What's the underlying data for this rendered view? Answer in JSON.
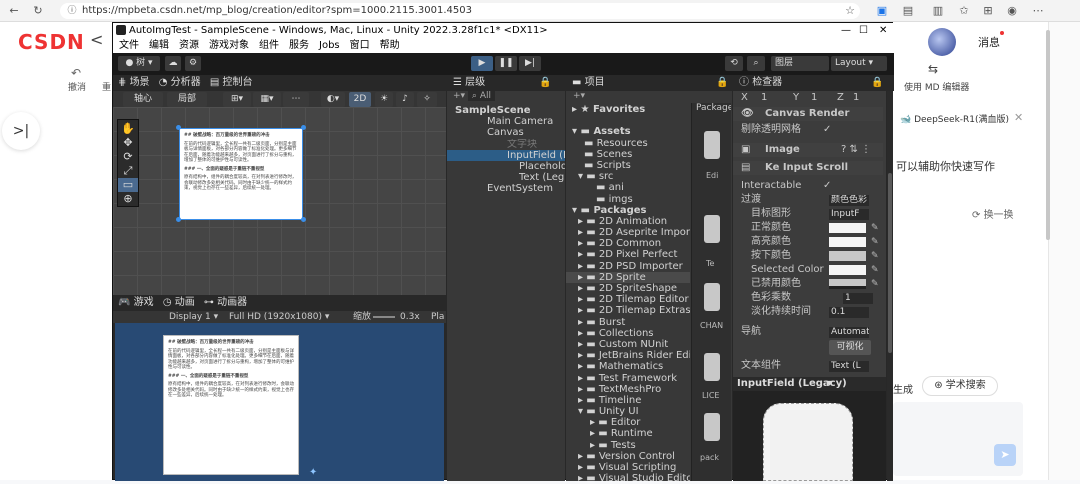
{
  "browser": {
    "url": "https://mpbeta.csdn.net/mp_blog/creation/editor?spm=1000.2115.3001.4503"
  },
  "csdn": {
    "logo": "CSDN",
    "back": "<",
    "undo": "撤消",
    "redo_partial": "重",
    "message": "消息",
    "md_editor": "使用 MD 编辑器",
    "ai_title": "DeepSeek-R1(满血版)",
    "ai_hint": "可以辅助你快速写作",
    "refresh": "换一换",
    "generate_partial": "生成",
    "academic": "学术搜索",
    "sidebar_toggle": ">|"
  },
  "unity": {
    "title": "AutoImgTest - SampleScene - Windows, Mac, Linux - Unity 2022.3.28f1c1* <DX11>",
    "menu": [
      "文件",
      "编辑",
      "资源",
      "游戏对象",
      "组件",
      "服务",
      "Jobs",
      "窗口",
      "帮助"
    ],
    "toolbar": {
      "account": "树",
      "layers": "图层",
      "layout": "Layout"
    },
    "scene": {
      "tabs": [
        "场景",
        "分析器",
        "控制台"
      ],
      "pivot": "轴心",
      "local": "局部",
      "mode2d": "2D"
    },
    "game": {
      "tabs": [
        "游戏",
        "动画",
        "动画器"
      ],
      "display": "Display 1",
      "resolution": "Full HD (1920x1080)",
      "scale_label": "缩放",
      "scale_value": "0.3x",
      "play_partial": "Pla"
    },
    "hierarchy": {
      "title": "层级",
      "search": "All",
      "items": [
        "SampleScene",
        "Main Camera",
        "Canvas",
        "文字块",
        "InputField (L",
        "Placehold",
        "Text (Leg",
        "EventSystem"
      ]
    },
    "project": {
      "title": "项目",
      "favorites": "Favorites",
      "assets": "Assets",
      "asset_items": [
        "Resources",
        "Scenes",
        "Scripts",
        "src",
        "ani",
        "imgs"
      ],
      "packages": "Packages",
      "package_items": [
        "2D Animation",
        "2D Aseprite Importer",
        "2D Common",
        "2D Pixel Perfect",
        "2D PSD Importer",
        "2D Sprite",
        "2D SpriteShape",
        "2D Tilemap Editor",
        "2D Tilemap Extras",
        "Burst",
        "Collections",
        "Custom NUnit",
        "JetBrains Rider Editor",
        "Mathematics",
        "Test Framework",
        "TextMeshPro",
        "Timeline",
        "Unity UI",
        "Editor",
        "Runtime",
        "Tests",
        "Version Control",
        "Visual Scripting",
        "Visual Studio Editor"
      ],
      "col_header": "Package",
      "col_items": [
        "Edi",
        "Te",
        "CHAN",
        "LICE",
        "pack"
      ]
    },
    "inspector": {
      "title": "检查器",
      "xyz": [
        "X",
        "Y",
        "Z"
      ],
      "xyz_vals": [
        "1",
        "1",
        "1"
      ],
      "canvas_renderer": "Canvas Render",
      "cull": "剔除透明网格",
      "image": "Image",
      "script": "Ke Input Scroll",
      "interactable": "Interactable",
      "transition": "过渡",
      "transition_val": "颜色色彩",
      "target": "目标图形",
      "target_val": "InputF",
      "normal": "正常颜色",
      "highlight": "高亮颜色",
      "pressed": "按下颜色",
      "selected": "Selected Color",
      "disabled": "已禁用颜色",
      "multiplier": "色彩乘数",
      "multiplier_val": "1",
      "fade": "淡化持续时间",
      "fade_val": "0.1",
      "navigation": "导航",
      "navigation_val": "Automati",
      "visualize": "可视化",
      "text_comp": "文本组件",
      "text_comp_val": "Text (L",
      "preview_title": "InputField (Legacy)"
    },
    "doc": {
      "title": "## 破壁战略：百万量级的世界重磅的冲击",
      "body": "在前的代码逻辑里，全长程一共有二级页面，分别是主面板与详情面板，对各部分内容做了标准化处理。更多细节在后面，随着功能越来越多，对页面进行了拆分与重构，增加了整体的可维护性与可读性。",
      "sub": "### 一、全面的疑惑是于重链不重视型",
      "body2": "原有结构中，组件的耦合度较高，在对列表进行修改时，会联动修改多处相关代码。同时由于缺少统一的样式约束，视觉上也存在一些差异，后续统一处理。"
    }
  },
  "colors": {
    "csdn_red": "#e33",
    "unity_dark": "#282828",
    "unity_panel": "#383838",
    "unity_select": "#2c5d87"
  }
}
